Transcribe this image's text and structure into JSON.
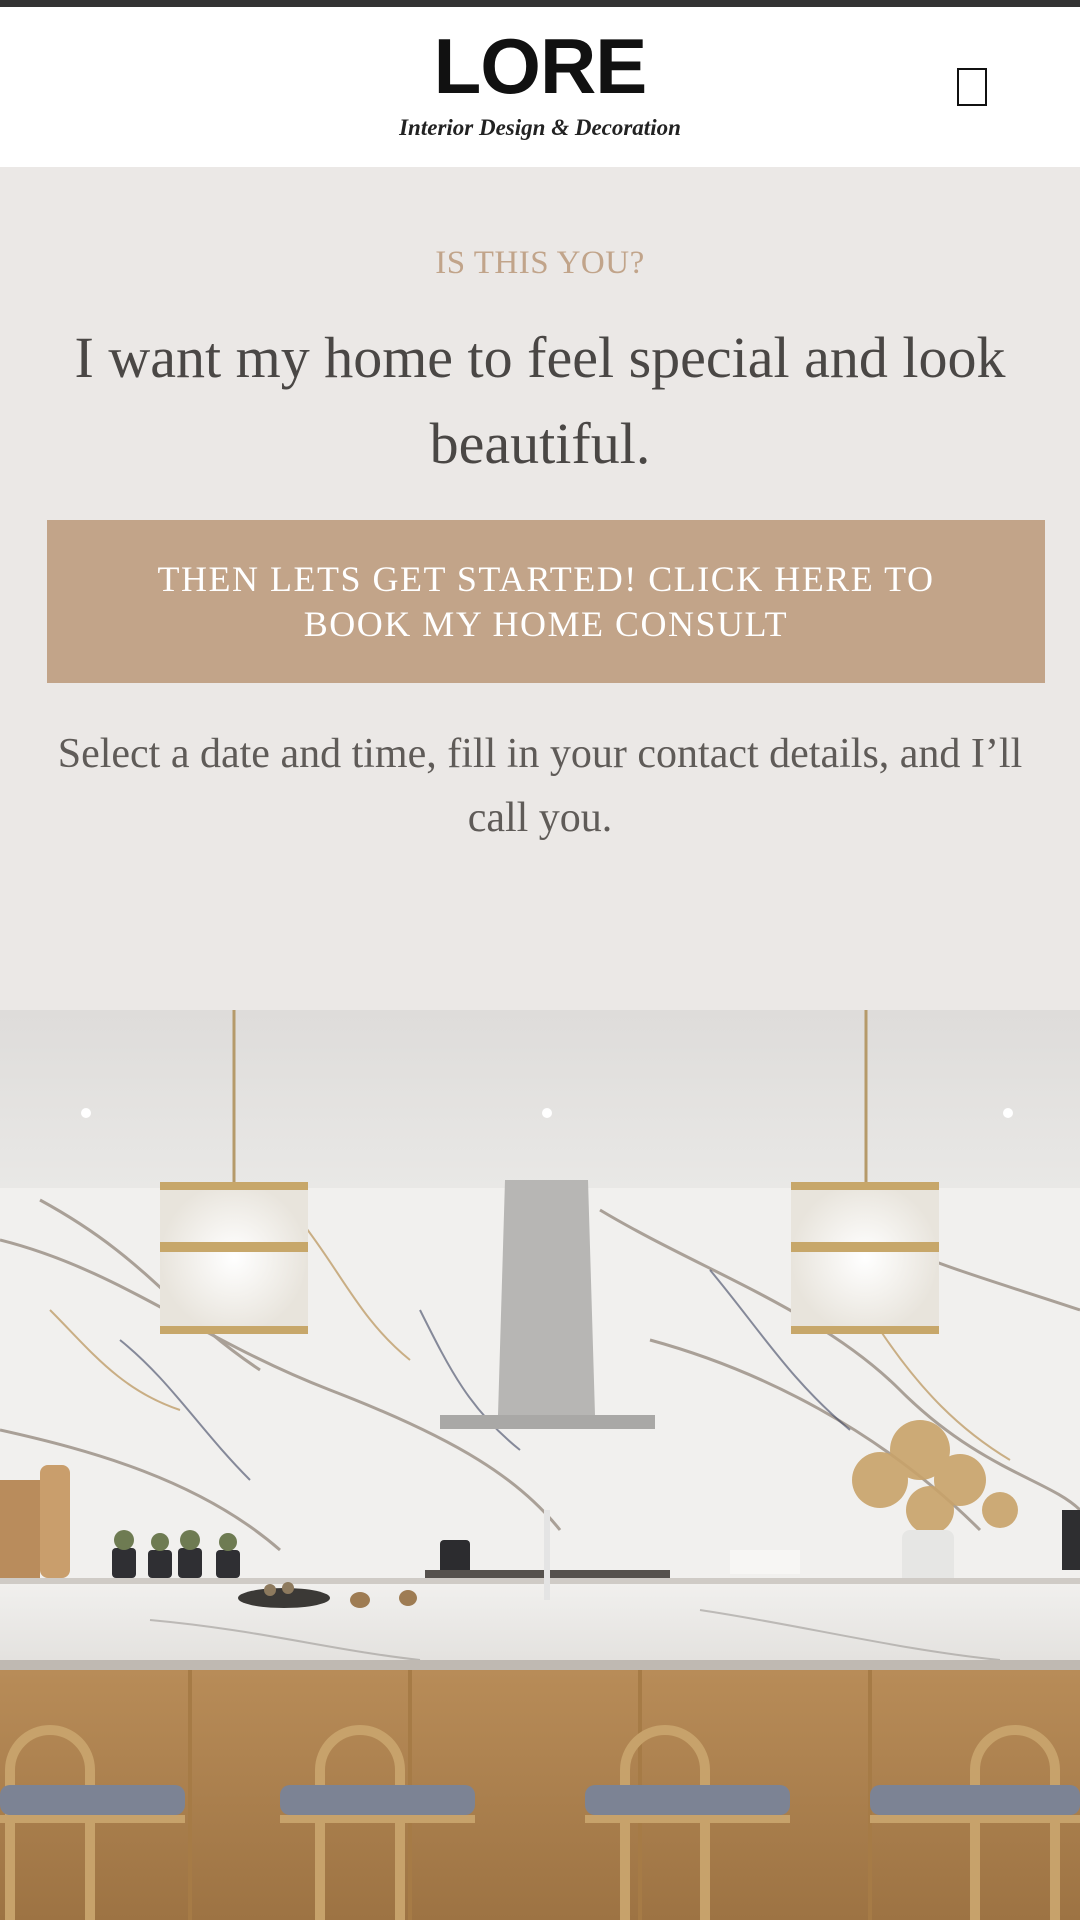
{
  "header": {
    "logo_title": "LORE",
    "logo_subtitle": "Interior Design & Decoration",
    "menu_icon": "hamburger-menu-icon"
  },
  "hero": {
    "eyebrow": "IS THIS YOU?",
    "headline": "I want my home to feel special and look beautiful.",
    "cta_label": "THEN LETS GET STARTED! CLICK HERE TO BOOK MY HOME CONSULT",
    "subtext": "Select a date and time, fill in your contact details, and I’ll call you."
  },
  "colors": {
    "background": "#ebe8e6",
    "accent": "#c2a489",
    "eyebrow": "#c1a48a",
    "headline": "#4a4745"
  }
}
